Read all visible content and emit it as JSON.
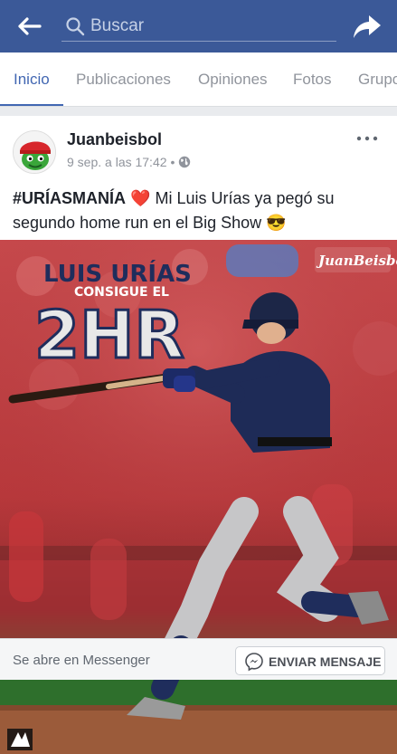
{
  "topbar": {
    "search_placeholder": "Buscar",
    "icons": {
      "back": "arrow-left-icon",
      "search": "search-icon",
      "share": "share-arrow-icon"
    },
    "background_color": "#3b5998"
  },
  "tabs": [
    {
      "label": "Inicio",
      "active": true
    },
    {
      "label": "Publicaciones",
      "active": false
    },
    {
      "label": "Opiniones",
      "active": false
    },
    {
      "label": "Fotos",
      "active": false
    },
    {
      "label": "Grupo",
      "active": false
    }
  ],
  "post": {
    "author": "Juanbeisbol",
    "timestamp": "9 sep. a las 17:42",
    "separator": "•",
    "hashtag": "#URÍASMANÍA",
    "text": "Mi Luis Urías ya pegó su segundo home run en el Big Show",
    "emoji_heart": "❤️",
    "emoji_sunglasses": "😎",
    "photo": {
      "headline": "LUIS URÍAS",
      "subheadline": "CONSIGUE EL",
      "big_text": "2HR",
      "logo_text": "JuanBeisbol"
    }
  },
  "footer": {
    "label": "Se abre en Messenger",
    "button_label": "ENVIAR MENSAJE",
    "icon": "messenger-icon"
  }
}
